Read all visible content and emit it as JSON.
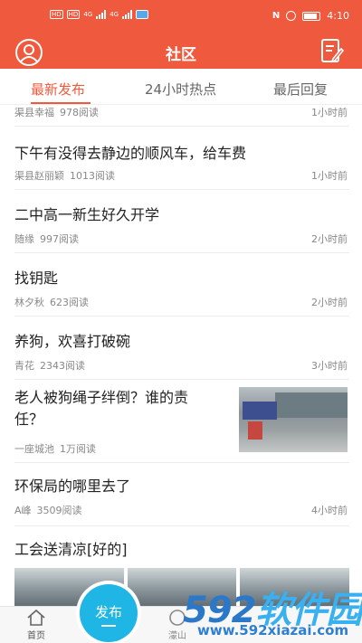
{
  "status_bar": {
    "time": "4:10",
    "net1": "4G",
    "net2": "4G",
    "sim1": "HD",
    "sim2": "HD"
  },
  "header": {
    "title": "社区"
  },
  "tabs": [
    {
      "label": "最新发布",
      "active": true
    },
    {
      "label": "24小时热点",
      "active": false
    },
    {
      "label": "最后回复",
      "active": false
    }
  ],
  "posts": [
    {
      "title": "",
      "author": "渠县幸福",
      "reads": "978阅读",
      "time": "1小时前"
    },
    {
      "title": "下午有没得去静边的顺风车，给车费",
      "author": "渠县赵丽颖",
      "reads": "1013阅读",
      "time": "1小时前"
    },
    {
      "title": "二中高一新生好久开学",
      "author": "随缘",
      "reads": "997阅读",
      "time": "2小时前"
    },
    {
      "title": "找钥匙",
      "author": "林夕秋",
      "reads": "623阅读",
      "time": "2小时前"
    },
    {
      "title": "养狗，欢喜打破碗",
      "author": "青花",
      "reads": "2343阅读",
      "time": "3小时前"
    },
    {
      "title_line1": "老人被狗绳子绊倒？谁的责",
      "title_line2": "任？",
      "author": "一座城池",
      "reads": "1万阅读",
      "time": ""
    },
    {
      "title": "环保局的哪里去了",
      "author": "A峰",
      "reads": "3509阅读",
      "time": "4小时前"
    },
    {
      "title": "工会送清凉[好的]",
      "author": "",
      "reads": "",
      "time": ""
    }
  ],
  "bottom_nav": {
    "home_label": "首页",
    "publish_label": "发布",
    "third_label": "濛山"
  },
  "watermark": {
    "logo_digits": "592",
    "logo_text": "软件园",
    "url": "www.592xiazai.com"
  },
  "colors": {
    "brand": "#ef5a3f",
    "publish": "#1fb6e6"
  }
}
